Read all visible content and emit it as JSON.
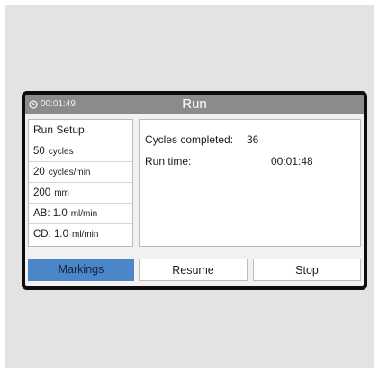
{
  "titlebar": {
    "timer": "00:01:49",
    "title": "Run",
    "timer_icon": "clock-icon"
  },
  "setup": {
    "title": "Run Setup",
    "rows": [
      {
        "value": "50",
        "unit": "cycles"
      },
      {
        "value": "20",
        "unit": "cycles/min"
      },
      {
        "value": "200",
        "unit": "mm"
      },
      {
        "value": "AB: 1.0",
        "unit": "ml/min"
      },
      {
        "value": "CD: 1.0",
        "unit": "ml/min"
      }
    ]
  },
  "status": {
    "cycles_label": "Cycles completed:",
    "cycles_value": "36",
    "runtime_label": "Run time:",
    "runtime_value": "00:01:48"
  },
  "buttons": {
    "markings": "Markings",
    "resume": "Resume",
    "stop": "Stop"
  },
  "colors": {
    "titlebar": "#8b8b8b",
    "accent_button": "#4a86c8",
    "bezel": "#0d0d0d",
    "backdrop": "#e3e3e1"
  }
}
